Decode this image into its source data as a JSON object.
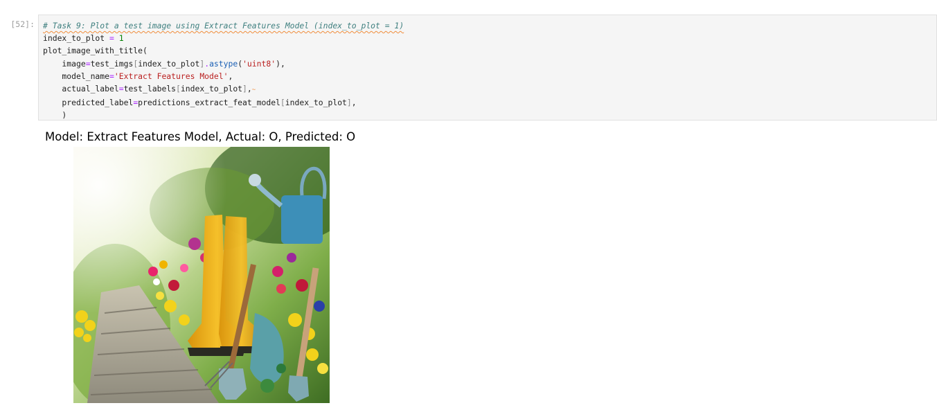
{
  "cell": {
    "prompt": "[52]:",
    "comment": "# Task 9: Plot a test image using Extract Features Model (index_to_plot = 1)",
    "line2": {
      "var": "index_to_plot",
      "eq": " = ",
      "num": "1"
    },
    "line3": "plot_image_with_title(",
    "line4": {
      "a": "    image",
      "b": "=",
      "c": "test_imgs",
      "d": "[",
      "e": "index_to_plot",
      "f": "]",
      "g": ".",
      "h": "astype",
      "i": "(",
      "j": "'uint8'",
      "k": ")",
      "l": ","
    },
    "line5": {
      "a": "    model_name",
      "b": "=",
      "c": "'Extract Features Model'",
      "d": ","
    },
    "line6": {
      "a": "    actual_label",
      "b": "=",
      "c": "test_labels",
      "d": "[",
      "e": "index_to_plot",
      "f": "]",
      "g": ","
    },
    "line7": {
      "a": "    predicted_label",
      "b": "=",
      "c": "predictions_extract_feat_model",
      "d": "[",
      "e": "index_to_plot",
      "f": "]",
      "g": ","
    },
    "line8": "    )"
  },
  "output": {
    "title": "Model: Extract Features Model, Actual: O, Predicted: O",
    "image_icon": "garden-boots-flowers-image"
  }
}
